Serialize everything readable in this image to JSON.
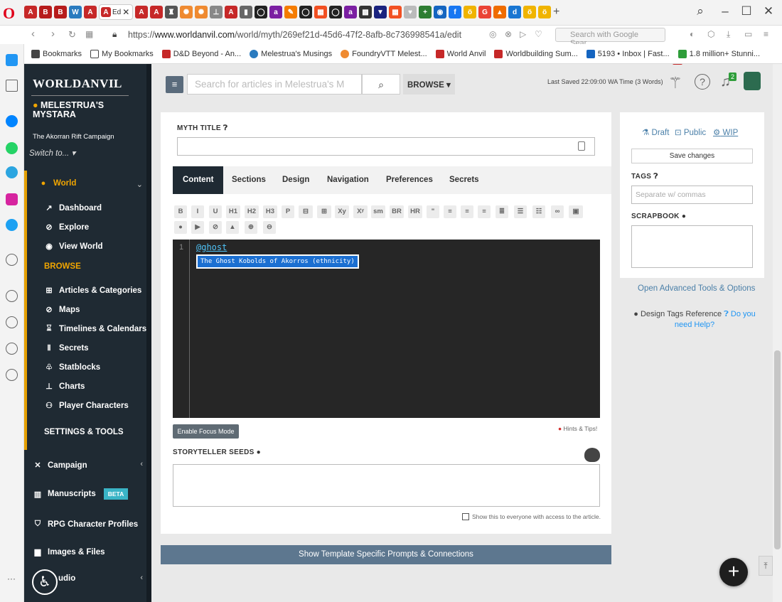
{
  "browser": {
    "url_prefix": "https://",
    "url_domain": "www.worldanvil.com",
    "url_path": "/world/myth/269ef21d-45d6-47f2-8afb-8c736998541a/edit",
    "search_placeholder": "Search with Google Sear...",
    "active_tab_label": "Ed"
  },
  "bookmarks": [
    {
      "label": "Bookmarks"
    },
    {
      "label": "My Bookmarks"
    },
    {
      "label": "D&D Beyond - An..."
    },
    {
      "label": "Melestrua's Musings"
    },
    {
      "label": "FoundryVTT Melest..."
    },
    {
      "label": "World Anvil"
    },
    {
      "label": "Worldbuilding Sum..."
    },
    {
      "label": "5193 • Inbox | Fast..."
    },
    {
      "label": "1.8 million+ Stunni..."
    }
  ],
  "sidebar": {
    "logo": "WORLDANVIL",
    "world_name": "MELESTRUA'S MYSTARA",
    "campaign": "The Akorran Rift Campaign",
    "switch_to": "Switch to...",
    "world_label": "World",
    "world_items": [
      {
        "label": "Dashboard",
        "icon": "dashboard-icon"
      },
      {
        "label": "Explore",
        "icon": "compass-icon"
      },
      {
        "label": "View World",
        "icon": "eye-icon"
      }
    ],
    "browse_label": "BROWSE",
    "browse_items": [
      {
        "label": "Articles & Categories",
        "icon": "sitemap-icon"
      },
      {
        "label": "Maps",
        "icon": "map-icon"
      },
      {
        "label": "Timelines & Calendars",
        "icon": "hourglass-icon"
      },
      {
        "label": "Secrets",
        "icon": "secrets-icon"
      },
      {
        "label": "Statblocks",
        "icon": "statblock-icon"
      },
      {
        "label": "Charts",
        "icon": "chart-icon"
      },
      {
        "label": "Player Characters",
        "icon": "users-icon"
      }
    ],
    "settings_label": "SETTINGS & TOOLS",
    "campaign_label": "Campaign",
    "manuscripts_label": "Manuscripts",
    "beta": "BETA",
    "rpg_label": "RPG Character Profiles",
    "images_label": "Images & Files",
    "audio_label": "udio"
  },
  "topbar": {
    "search_placeholder": "Search for articles in Melestrua's M",
    "browse": "BROWSE",
    "last_saved": "Last Saved 22:09:00 WA Time (3 Words)",
    "notification_count": "2"
  },
  "editor": {
    "myth_title_label": "MYTH TITLE",
    "tabs": [
      "Content",
      "Sections",
      "Design",
      "Navigation",
      "Preferences",
      "Secrets"
    ],
    "toolbar_row1": [
      "B",
      "I",
      "U",
      "H1",
      "H2",
      "H3",
      "P",
      "",
      "",
      "Xy",
      "Xʸ",
      "sm",
      "BR",
      "HR",
      "\""
    ],
    "line_number": "1",
    "mention_text": "@ghost",
    "autocomplete": "The Ghost Kobolds of Akorros (ethnicity)",
    "focus_mode": "Enable Focus Mode",
    "hints": "Hints & Tips!",
    "storyteller_label": "STORYTELLER SEEDS",
    "show_everyone": "Show this to everyone with access to the article.",
    "prompts_button": "Show Template Specific Prompts & Connections"
  },
  "rightpanel": {
    "draft": "Draft",
    "public": "Public",
    "wip": "WIP",
    "save": "Save changes",
    "tags_label": "TAGS",
    "tags_placeholder": "Separate w/ commas",
    "scrapbook_label": "SCRAPBOOK",
    "advanced": "Open Advanced Tools & Options",
    "design_ref": "Design Tags Reference",
    "need_help": "Do you need Help?"
  },
  "colors": {
    "sidebar": "#1f2a33",
    "accent": "#f0a500",
    "link": "#4a7fa8",
    "prompt_btn": "#5d778f"
  }
}
